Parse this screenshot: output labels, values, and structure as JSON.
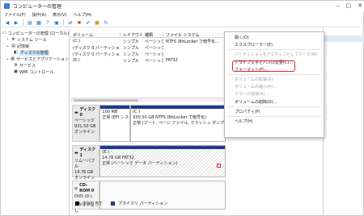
{
  "window": {
    "title": "コンピューターの管理"
  },
  "menubar": [
    "ファイル(F)",
    "操作(A)",
    "表示(V)",
    "ヘルプ(H)"
  ],
  "tree": [
    {
      "label": "コンピューターの管理 (ローカル)",
      "level": 0,
      "icon": "computer-icon",
      "selected": false
    },
    {
      "label": "システム ツール",
      "level": 1,
      "icon": "tools-icon",
      "selected": false
    },
    {
      "label": "記憶域",
      "level": 1,
      "icon": "storage-icon",
      "selected": false
    },
    {
      "label": "ディスクの管理",
      "level": 2,
      "icon": "disk-icon",
      "selected": true
    },
    {
      "label": "サービスとアプリケーション",
      "level": 1,
      "icon": "services-icon",
      "selected": false
    },
    {
      "label": "サービス",
      "level": 2,
      "icon": "gear-icon",
      "selected": false
    },
    {
      "label": "WMI コントロール",
      "level": 2,
      "icon": "wmi-icon",
      "selected": false
    }
  ],
  "volume_table": {
    "headers": [
      "ボリューム",
      "レイアウト",
      "種類",
      "ファイル システム"
    ],
    "rows": [
      [
        "(C:)",
        "シンプル",
        "ベーシック",
        "NTFS (BitLocker で暗号化..."
      ],
      [
        "(ディスク 0 パーティション 1)",
        "シンプル",
        "ベーシック",
        ""
      ],
      [
        "(ディスク 0 パーティション 4)",
        "シンプル",
        "ベーシック",
        ""
      ],
      [
        "(E:)",
        "シンプル",
        "ベーシック",
        "FAT32"
      ]
    ]
  },
  "disks": [
    {
      "name": "ディスク 0",
      "type": "ベーシック",
      "size": "931.50 GB",
      "status": "オンライン",
      "partitions": [
        {
          "label": "",
          "size": "100 MB",
          "status": "正常 (EFI シス"
        },
        {
          "label": "(C:)",
          "size": "930.50 GB NTFS (BitLocker で暗号化)",
          "status": "正常 (ブート, ページ ファイル, クラッシュ ダンプ"
        }
      ]
    },
    {
      "name": "ディスク 1",
      "type": "リムーバブル",
      "size": "14.76 GB",
      "status": "オンライン",
      "partitions": [
        {
          "label": "(E:)",
          "size": "14.76 GB FAT32",
          "status": "正常 (ベーシック データ パーティション)"
        }
      ]
    },
    {
      "name": "CD-ROM 0",
      "type": "DVD (D:)",
      "size": "",
      "status": "メディアなし",
      "partitions": []
    }
  ],
  "legend": [
    {
      "label": "未割り当て",
      "color": "#000000"
    },
    {
      "label": "プライマリ パーティション",
      "color": "#1f3b8c"
    }
  ],
  "context_menu": [
    {
      "label": "開く(O)",
      "disabled": false
    },
    {
      "label": "エクスプローラー(E)",
      "disabled": false
    },
    {
      "sep": true
    },
    {
      "label": "パーティションをアクティブとしてマーク(M)",
      "disabled": true
    },
    {
      "label": "ドライブ文字とパスの変更(C)...",
      "disabled": false,
      "highlighted": true
    },
    {
      "label": "フォーマット(F)...",
      "disabled": false
    },
    {
      "sep": true
    },
    {
      "label": "ボリュームの拡張(X)...",
      "disabled": true
    },
    {
      "label": "ボリュームの縮小(H)...",
      "disabled": true
    },
    {
      "label": "ミラーの追加(A)...",
      "disabled": true
    },
    {
      "label": "ボリュームの削除(D)...",
      "disabled": false
    },
    {
      "sep": true
    },
    {
      "label": "プロパティ(P)",
      "disabled": false
    },
    {
      "sep": true
    },
    {
      "label": "ヘルプ(H)",
      "disabled": false
    }
  ],
  "colors": {
    "primary_partition": "#1f3b8c",
    "highlight_ring": "#e02020",
    "selection": "#cce4f7"
  }
}
